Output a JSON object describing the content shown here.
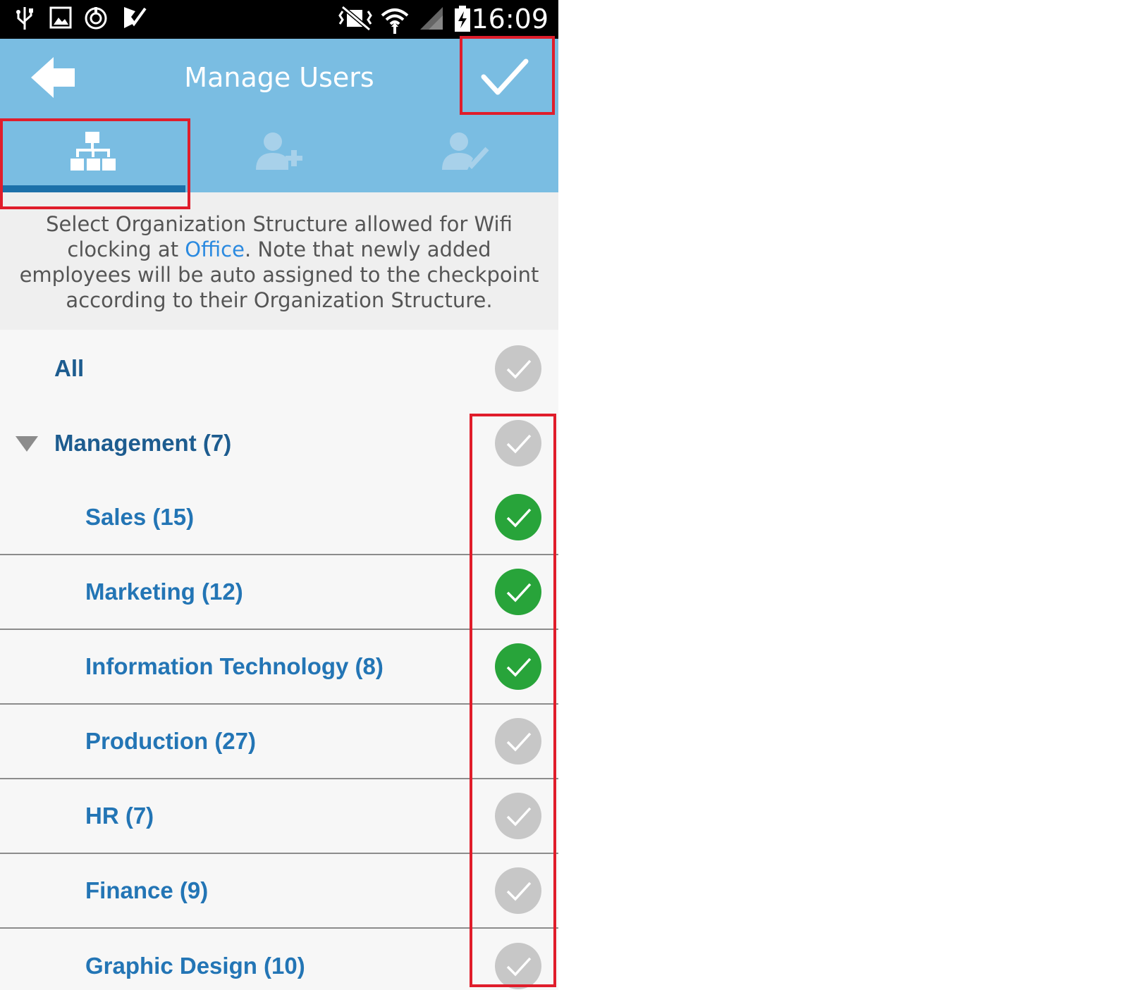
{
  "status_bar": {
    "time": "16:09",
    "icons": [
      "usb-icon",
      "image-icon",
      "sync-icon",
      "task-icon",
      "vibrate-icon",
      "wifi-icon",
      "signal-icon",
      "battery-charging-icon"
    ]
  },
  "header": {
    "title": "Manage Users",
    "back_icon": "back-arrow-icon",
    "confirm_icon": "checkmark-icon"
  },
  "tabs": [
    {
      "icon": "org-structure-icon",
      "active": true
    },
    {
      "icon": "add-user-icon",
      "active": false
    },
    {
      "icon": "user-check-icon",
      "active": false
    }
  ],
  "description": {
    "part1": "Select Organization Structure allowed for Wifi clocking at ",
    "link": "Office",
    "part2": ". Note that newly added employees will be auto assigned to the checkpoint according to their Organization Structure."
  },
  "colors": {
    "header": "#7abde2",
    "tab_indicator": "#1c70a9",
    "checked": "#28a43a",
    "unchecked": "#c7c7c7",
    "annotation": "#e01d2b",
    "link": "#2b8ae0"
  },
  "org_list": {
    "all": {
      "label": "All",
      "checked": false
    },
    "groups": [
      {
        "label": "Management (7)",
        "checked": false,
        "expanded": true,
        "children": [
          {
            "label": "Sales (15)",
            "checked": true
          },
          {
            "label": "Marketing (12)",
            "checked": true
          },
          {
            "label": "Information Technology (8)",
            "checked": true
          },
          {
            "label": "Production (27)",
            "checked": false
          },
          {
            "label": "HR (7)",
            "checked": false
          },
          {
            "label": "Finance (9)",
            "checked": false
          },
          {
            "label": "Graphic Design (10)",
            "checked": false
          }
        ]
      }
    ]
  }
}
